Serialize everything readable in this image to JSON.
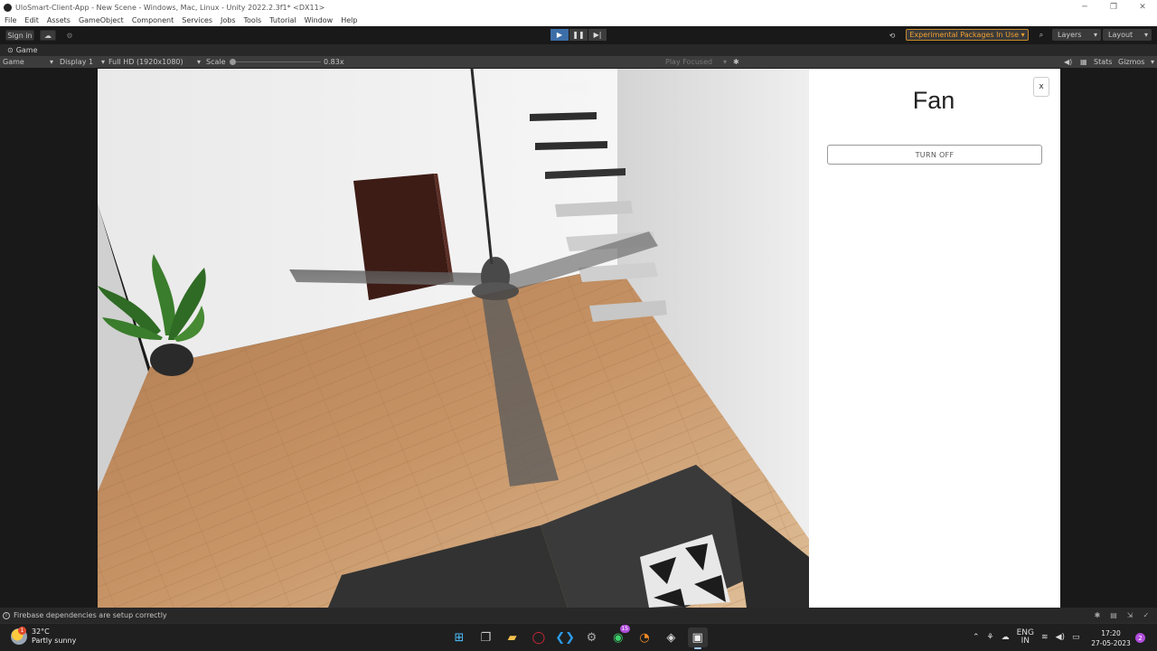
{
  "window": {
    "title": "UloSmart-Client-App - New Scene - Windows, Mac, Linux - Unity 2022.2.3f1* <DX11>"
  },
  "menu": [
    "File",
    "Edit",
    "Assets",
    "GameObject",
    "Component",
    "Services",
    "Jobs",
    "Tools",
    "Tutorial",
    "Window",
    "Help"
  ],
  "toolbar": {
    "sign_in": "Sign in",
    "experimental": "Experimental Packages In Use ▾",
    "layers": "Layers",
    "layout": "Layout"
  },
  "game_tab": {
    "label": "Game"
  },
  "game_bar": {
    "mode": "Game",
    "display": "Display 1",
    "resolution": "Full HD (1920x1080)",
    "scale_label": "Scale",
    "scale_value": "0.83x",
    "scale_fraction": 0.0,
    "play_focused": "Play Focused",
    "stats": "Stats",
    "gizmos": "Gizmos"
  },
  "panel": {
    "close": "x",
    "heading": "Fan",
    "toggle_label": "TURN OFF"
  },
  "status": {
    "message": "Firebase dependencies are setup correctly"
  },
  "taskbar": {
    "temperature": "32°C",
    "weather": "Partly sunny",
    "weather_badge": "1",
    "whatsapp_badge": "15",
    "lang_top": "ENG",
    "lang_bottom": "IN",
    "time": "17:20",
    "date": "27-05-2023",
    "notifications": "2"
  }
}
